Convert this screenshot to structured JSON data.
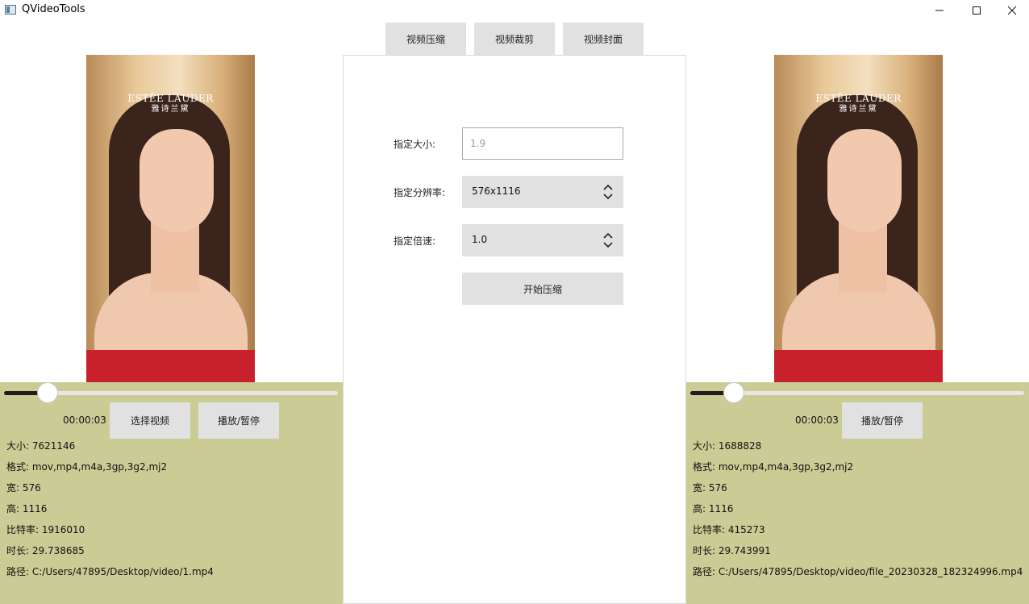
{
  "window": {
    "title": "QVideoTools"
  },
  "tabs": [
    {
      "label": "视频压缩"
    },
    {
      "label": "视频裁剪"
    },
    {
      "label": "视频封面"
    }
  ],
  "form": {
    "size_label": "指定大小:",
    "size_placeholder": "1.9",
    "resolution_label": "指定分辨率:",
    "resolution_value": "576x1116",
    "speed_label": "指定倍速:",
    "speed_value": "1.0",
    "start_button": "开始压缩"
  },
  "preview": {
    "logo_line1": "ESTĒE LAUDER",
    "logo_line2": "雅诗兰黛"
  },
  "source": {
    "progress": 0.13,
    "time": "00:00:03",
    "select_button": "选择视频",
    "play_button": "播放/暂停",
    "size": "大小: 7621146",
    "format": "格式: mov,mp4,m4a,3gp,3g2,mj2",
    "width": "宽: 576",
    "height": "高: 1116",
    "bitrate": "比特率: 1916010",
    "duration": "时长: 29.738685",
    "path": "路径: C:/Users/47895/Desktop/video/1.mp4"
  },
  "output": {
    "progress": 0.13,
    "time": "00:00:03",
    "play_button": "播放/暂停",
    "size": "大小: 1688828",
    "format": "格式: mov,mp4,m4a,3gp,3g2,mj2",
    "width": "宽: 576",
    "height": "高: 1116",
    "bitrate": "比特率: 415273",
    "duration": "时长: 29.743991",
    "path": "路径: C:/Users/47895/Desktop/video/file_20230328_182324996.mp4"
  }
}
